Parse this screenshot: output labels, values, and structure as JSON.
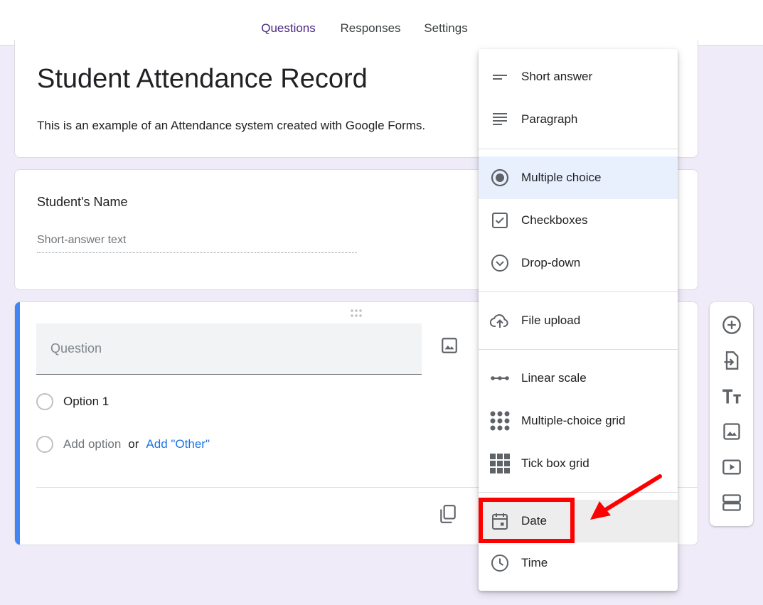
{
  "tabs": [
    {
      "label": "Questions",
      "active": true
    },
    {
      "label": "Responses",
      "active": false
    },
    {
      "label": "Settings",
      "active": false
    }
  ],
  "form": {
    "title": "Student Attendance Record",
    "description": "This is an example of an Attendance system created with Google Forms."
  },
  "name_question": {
    "title": "Student's Name",
    "answer_placeholder": "Short-answer text"
  },
  "edit_question": {
    "placeholder": "Question",
    "option_1": "Option 1",
    "add_option": "Add option",
    "or": "or",
    "add_other": "Add \"Other\""
  },
  "menu": {
    "items": [
      {
        "label": "Short answer",
        "icon": "short-answer-icon"
      },
      {
        "label": "Paragraph",
        "icon": "paragraph-icon"
      },
      {
        "label": "Multiple choice",
        "icon": "radio-button-icon",
        "selected": true
      },
      {
        "label": "Checkboxes",
        "icon": "checkbox-icon"
      },
      {
        "label": "Drop-down",
        "icon": "dropdown-circle-icon"
      },
      {
        "label": "File upload",
        "icon": "cloud-upload-icon"
      },
      {
        "label": "Linear scale",
        "icon": "linear-scale-icon"
      },
      {
        "label": "Multiple-choice grid",
        "icon": "dot-grid-icon"
      },
      {
        "label": "Tick box grid",
        "icon": "square-grid-icon"
      },
      {
        "label": "Date",
        "icon": "calendar-icon",
        "highlighted": true
      },
      {
        "label": "Time",
        "icon": "clock-icon"
      }
    ]
  },
  "colors": {
    "accent": "#673ab7",
    "background": "#efebf8",
    "question_bar": "#4285f4",
    "link": "#1a73e8",
    "annotation": "#ff0000"
  }
}
